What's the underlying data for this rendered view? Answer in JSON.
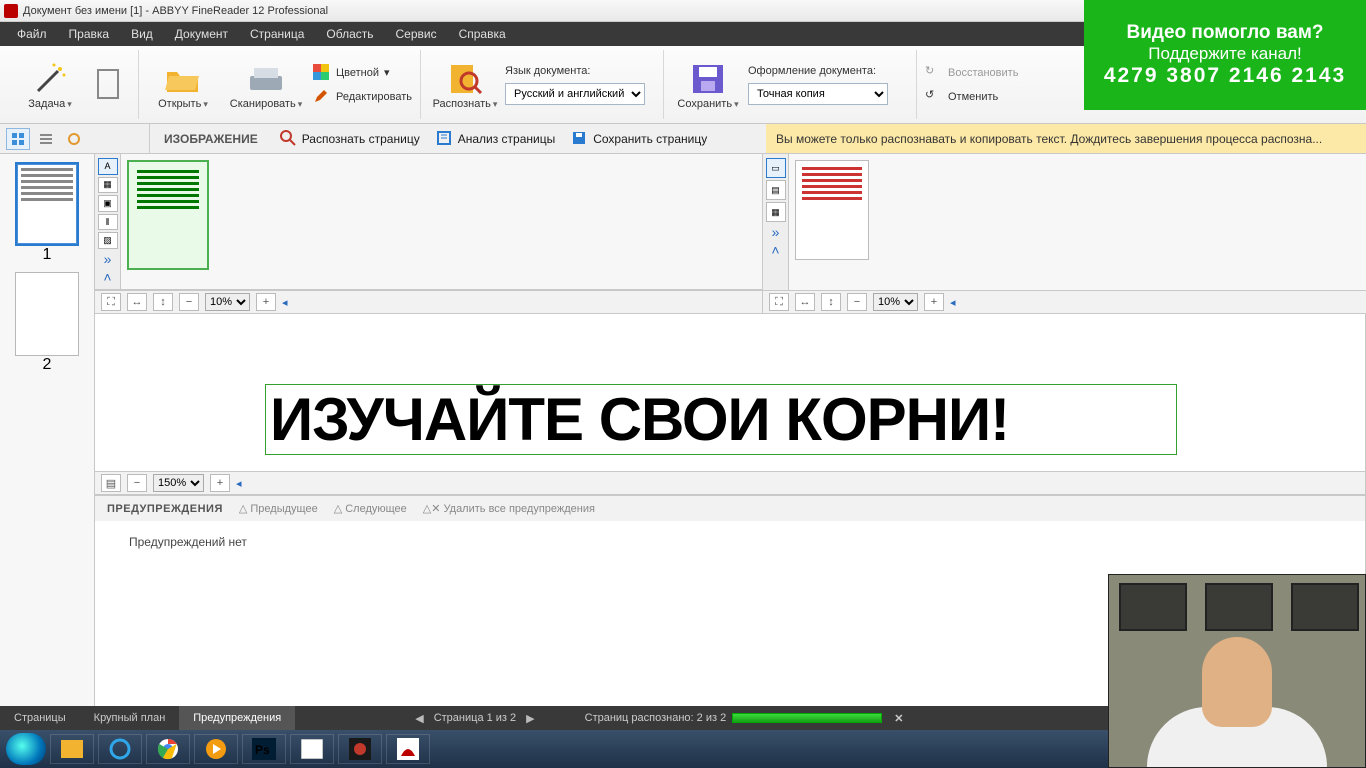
{
  "title": "Документ без имени [1] - ABBYY FineReader 12 Professional",
  "menu": [
    "Файл",
    "Правка",
    "Вид",
    "Документ",
    "Страница",
    "Область",
    "Сервис",
    "Справка"
  ],
  "ribbon": {
    "task": "Задача",
    "open": "Открыть",
    "scan": "Сканировать",
    "color": "Цветной",
    "edit": "Редактировать",
    "recognize": "Распознать",
    "lang_label": "Язык документа:",
    "lang_value": "Русский и английский",
    "save": "Сохранить",
    "layout_label": "Оформление документа:",
    "layout_value": "Точная копия",
    "restore": "Восстановить",
    "undo": "Отменить"
  },
  "sub": {
    "image_title": "ИЗОБРАЖЕНИЕ",
    "recognize_page": "Распознать страницу",
    "analyze_page": "Анализ страницы",
    "save_page": "Сохранить страницу",
    "info_msg": "Вы можете только распознавать и копировать текст. Дождитесь завершения процесса распозна..."
  },
  "pages": {
    "p1": "1",
    "p2": "2"
  },
  "zoom": {
    "ten": "10%",
    "onefifty": "150%"
  },
  "canvas_text": "ИЗУЧАЙТЕ СВОИ КОРНИ!",
  "warnings": {
    "title": "ПРЕДУПРЕЖДЕНИЯ",
    "prev": "Предыдущее",
    "next": "Следующее",
    "delete_all": "Удалить все предупреждения",
    "none": "Предупреждений нет"
  },
  "tabs": {
    "pages": "Страницы",
    "closeup": "Крупный план",
    "warnings": "Предупреждения"
  },
  "status": {
    "page": "Страница 1 из 2",
    "recognized": "Страниц распознано: 2 из 2"
  },
  "banner": {
    "l1": "Видео помогло вам?",
    "l2": "Поддержите канал!",
    "l3": "4279 3807 2146 2143"
  }
}
